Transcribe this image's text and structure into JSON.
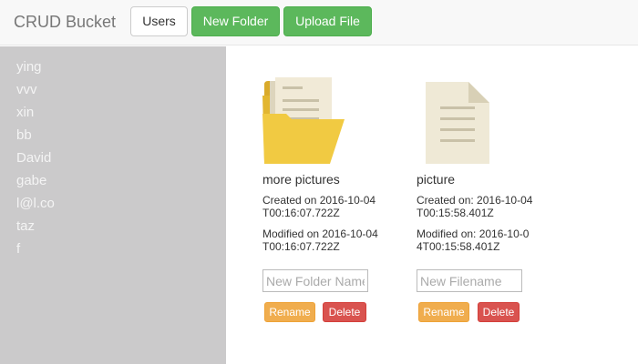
{
  "navbar": {
    "brand": "CRUD Bucket",
    "users_button": "Users",
    "new_folder_button": "New Folder",
    "upload_file_button": "Upload File"
  },
  "sidebar": {
    "users": [
      "ying",
      "vvv",
      "xin",
      "bb",
      "David",
      "gabe",
      "l@l.co",
      "taz",
      "f"
    ]
  },
  "items": [
    {
      "icon": "folder-icon",
      "name": "more pictures",
      "created": "Created on 2016-10-04T00:16:07.722Z",
      "modified": "Modified on 2016-10-04T00:16:07.722Z",
      "placeholder": "New Folder Name",
      "rename_label": "Rename",
      "delete_label": "Delete"
    },
    {
      "icon": "file-icon",
      "name": "picture",
      "created": "Created on: 2016-10-04T00:15:58.401Z",
      "modified": "Modified on: 2016-10-04T00:15:58.401Z",
      "placeholder": "New Filename",
      "rename_label": "Rename",
      "delete_label": "Delete"
    }
  ],
  "colors": {
    "success": "#5cb85c",
    "warning": "#f0ad4e",
    "danger": "#d9534f",
    "sidebar_bg": "#cbcacb",
    "folder": "#f1ca42",
    "file": "#efe9d6"
  }
}
